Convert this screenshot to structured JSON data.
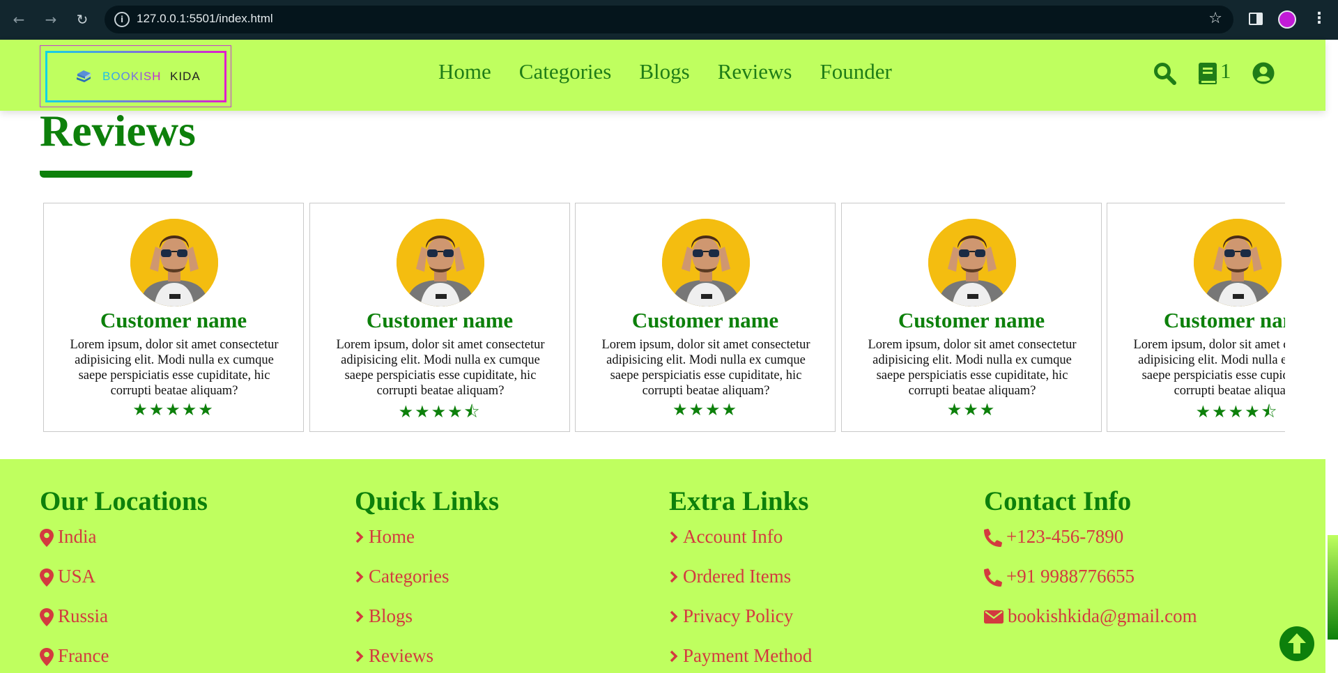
{
  "browser": {
    "url": "127.0.0.1:5501/index.html",
    "icons": [
      "back-icon",
      "forward-icon",
      "reload-icon",
      "site-info-icon",
      "bookmark-star-icon",
      "side-panel-icon",
      "profile-icon",
      "menu-kebab-icon"
    ]
  },
  "header": {
    "logo_part1": "BOOKISH",
    "logo_part2": "KIDA",
    "nav": [
      "Home",
      "Categories",
      "Blogs",
      "Reviews",
      "Founder"
    ],
    "cart_count": "1",
    "icons": [
      "search-icon",
      "book-cart-icon",
      "user-icon"
    ]
  },
  "reviews": {
    "title": "Reviews",
    "cards": [
      {
        "name": "Customer name",
        "text": "Lorem ipsum, dolor sit amet consectetur adipisicing elit. Modi nulla ex cumque saepe perspiciatis esse cupiditate, hic corrupti beatae aliquam?",
        "rating": 5
      },
      {
        "name": "Customer name",
        "text": "Lorem ipsum, dolor sit amet consectetur adipisicing elit. Modi nulla ex cumque saepe perspiciatis esse cupiditate, hic corrupti beatae aliquam?",
        "rating": 4.5
      },
      {
        "name": "Customer name",
        "text": "Lorem ipsum, dolor sit amet consectetur adipisicing elit. Modi nulla ex cumque saepe perspiciatis esse cupiditate, hic corrupti beatae aliquam?",
        "rating": 4
      },
      {
        "name": "Customer name",
        "text": "Lorem ipsum, dolor sit amet consectetur adipisicing elit. Modi nulla ex cumque saepe perspiciatis esse cupiditate, hic corrupti beatae aliquam?",
        "rating": 3
      },
      {
        "name": "Customer name",
        "text": "Lorem ipsum, dolor sit amet consectetur adipisicing elit. Modi nulla ex cumque saepe perspiciatis esse cupiditate, hic corrupti beatae aliquam?",
        "rating": 4.5
      }
    ]
  },
  "footer": {
    "locations": {
      "title": "Our Locations",
      "items": [
        "India",
        "USA",
        "Russia",
        "France"
      ]
    },
    "quick_links": {
      "title": "Quick Links",
      "items": [
        "Home",
        "Categories",
        "Blogs",
        "Reviews"
      ]
    },
    "extra_links": {
      "title": "Extra Links",
      "items": [
        "Account Info",
        "Ordered Items",
        "Privacy Policy",
        "Payment Method"
      ]
    },
    "contact": {
      "title": "Contact Info",
      "items": [
        "+123-456-7890",
        "+91 9988776655",
        "bookishkida@gmail.com"
      ]
    }
  },
  "colors": {
    "accent_green": "#0d800b",
    "header_bg": "#bfff5f",
    "link_red": "#d33a3f"
  }
}
